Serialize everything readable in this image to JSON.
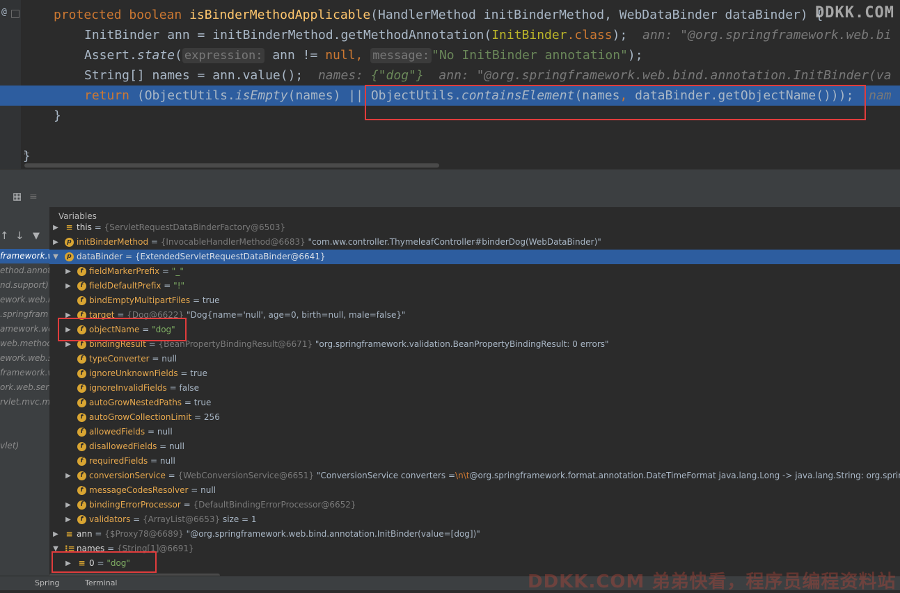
{
  "editor": {
    "gutter_at": "@",
    "line1": {
      "kw": "protected boolean ",
      "fn": "isBinderMethodApplicable",
      "rest": "(HandlerMethod initBinderMethod, WebDataBinder dataBinder) {"
    },
    "line2": {
      "type": "InitBinder",
      "mid": " ann = initBinderMethod.getMethodAnnotation(",
      "ann": "InitBinder",
      "kw": ".class",
      "end": ");",
      "hint": "ann: \"@org.springframework.web.bi"
    },
    "line3": {
      "pre": "Assert.",
      "fn": "state",
      "open": "(",
      "h1": "expression:",
      "mid": " ann != ",
      "kw": "null",
      "comma": ",",
      "h2": "message:",
      "str": "\"No InitBinder annotation\"",
      "end": ");"
    },
    "line4": {
      "pre": "String[] names = ann.value();",
      "hint1": "names:",
      "hint1v": "{\"dog\"}",
      "hint2": "ann: \"@org.springframework.web.bind.annotation.InitBinder(va"
    },
    "line5": {
      "kw": "return",
      "p1": " (ObjectUtils.",
      "fn1": "isEmpty",
      "p2": "(names) || ",
      "p3": "ObjectUtils.",
      "fn2": "containsElement",
      "p4": "(names",
      "comma": ",",
      "p5": " dataBinder.getObjectName()));",
      "hint": "nam"
    },
    "line6": "}",
    "line8": "}",
    "watermark": "DDKK.COM"
  },
  "toolbar": {
    "icon1": "▦",
    "icon2": "≡"
  },
  "frames": {
    "up": "↑",
    "down": "↓",
    "filter": "▼",
    "items": [
      "framework.we",
      "ethod.annota",
      "nd.support)",
      "ework.web.m",
      ".springfram",
      "amework.we",
      "web.method",
      "ework.web.se",
      "framework.w",
      "ork.web.serv",
      "rvlet.mvc.me",
      "",
      "",
      "vlet)"
    ]
  },
  "variables": {
    "title": "Variables",
    "rows": [
      {
        "name": "this",
        "ref": "{ServletRequestDataBinderFactory@6503}",
        "val": ""
      },
      {
        "name": "initBinderMethod",
        "ref": "{InvocableHandlerMethod@6683}",
        "val": "\"com.ww.controller.ThymeleafController#binderDog(WebDataBinder)\""
      },
      {
        "name": "dataBinder",
        "ref": "{ExtendedServletRequestDataBinder@6641}",
        "val": ""
      },
      {
        "name": "fieldMarkerPrefix",
        "ref": "",
        "val": "\"_\""
      },
      {
        "name": "fieldDefaultPrefix",
        "ref": "",
        "val": "\"!\""
      },
      {
        "name": "bindEmptyMultipartFiles",
        "ref": "",
        "val": "true"
      },
      {
        "name": "target",
        "ref": "{Dog@6622}",
        "val": "\"Dog{name='null', age=0, birth=null, male=false}\""
      },
      {
        "name": "objectName",
        "ref": "",
        "val": "\"dog\""
      },
      {
        "name": "bindingResult",
        "ref": "{BeanPropertyBindingResult@6671}",
        "val": "\"org.springframework.validation.BeanPropertyBindingResult: 0 errors\""
      },
      {
        "name": "typeConverter",
        "ref": "",
        "val": "null"
      },
      {
        "name": "ignoreUnknownFields",
        "ref": "",
        "val": "true"
      },
      {
        "name": "ignoreInvalidFields",
        "ref": "",
        "val": "false"
      },
      {
        "name": "autoGrowNestedPaths",
        "ref": "",
        "val": "true"
      },
      {
        "name": "autoGrowCollectionLimit",
        "ref": "",
        "val": "256"
      },
      {
        "name": "allowedFields",
        "ref": "",
        "val": "null"
      },
      {
        "name": "disallowedFields",
        "ref": "",
        "val": "null"
      },
      {
        "name": "requiredFields",
        "ref": "",
        "val": "null"
      },
      {
        "name": "conversionService",
        "ref": "{WebConversionService@6651}",
        "val_pre": "\"ConversionService converters =",
        "val_esc": "\\n\\t",
        "val_post": "@org.springframework.format.annotation.DateTimeFormat java.lang.Long -> java.lang.String: org.springframew"
      },
      {
        "name": "messageCodesResolver",
        "ref": "",
        "val": "null"
      },
      {
        "name": "bindingErrorProcessor",
        "ref": "{DefaultBindingErrorProcessor@6652}",
        "val": ""
      },
      {
        "name": "validators",
        "ref": "{ArrayList@6653}",
        "val": "size = 1"
      },
      {
        "name": "ann",
        "ref": "{$Proxy78@6689}",
        "val": "\"@org.springframework.web.bind.annotation.InitBinder(value=[dog])\""
      },
      {
        "name": "names",
        "ref": "{String[1]@6691}",
        "val": ""
      },
      {
        "name": "0",
        "ref": "",
        "val": "\"dog\""
      }
    ]
  },
  "bottom": {
    "tab1": "Spring",
    "tab2": "Terminal"
  },
  "watermark2": "DDKK.COM 弟弟快看，程序员编程资料站"
}
